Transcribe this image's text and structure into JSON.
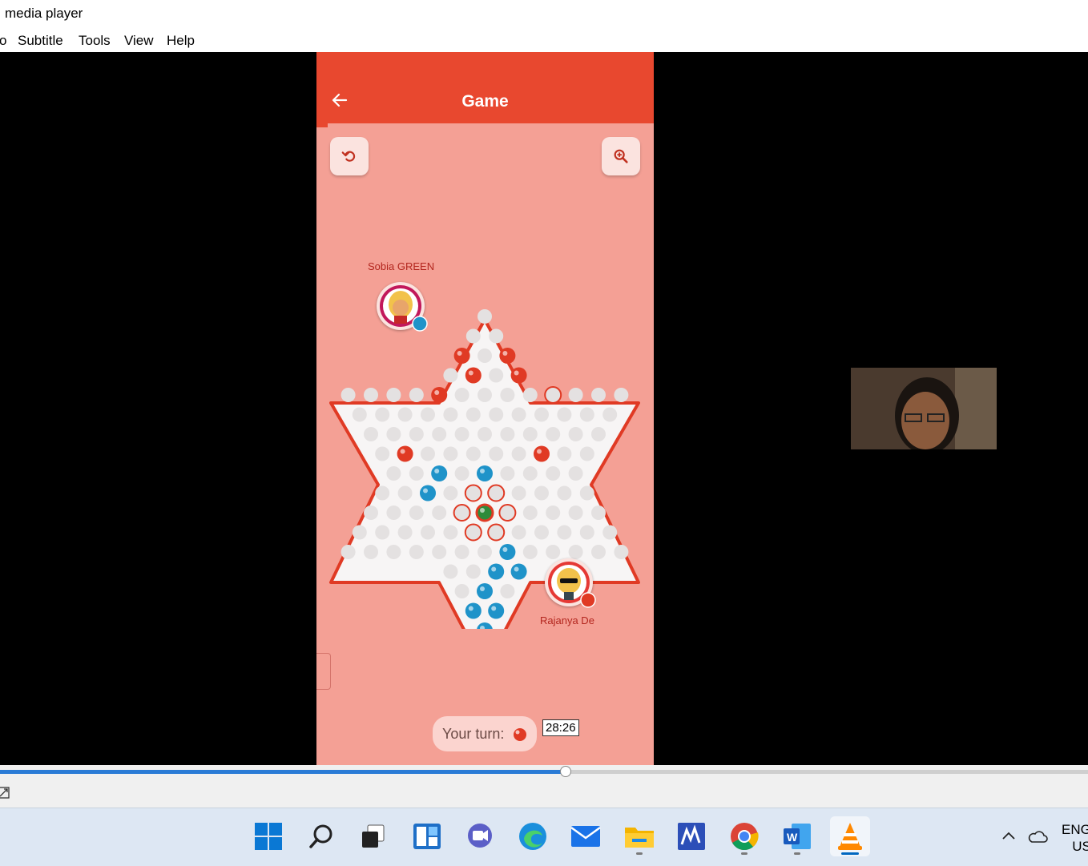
{
  "window": {
    "title": "media player"
  },
  "menu": {
    "items": [
      "o",
      "Subtitle",
      "Tools",
      "View",
      "Help"
    ]
  },
  "game": {
    "title": "Game",
    "player_top": "Sobia GREEN",
    "player_bottom": "Rajanya De",
    "turn_label": "Your turn:",
    "colors": {
      "appbar": "#e8482f",
      "background": "#f4a095",
      "red_marble": "#e03a24",
      "blue_marble": "#1f93c9",
      "green_marble": "#2e8b3a"
    }
  },
  "seek": {
    "tooltip_time": "28:26",
    "progress": 0.52
  },
  "taskbar": {
    "icons": [
      "windows-start-icon",
      "search-icon",
      "task-view-icon",
      "widgets-icon",
      "teams-chat-icon",
      "edge-icon",
      "mail-icon",
      "file-explorer-icon",
      "mathcad-icon",
      "chrome-icon",
      "word-icon",
      "vlc-icon"
    ],
    "lang_line1": "ENG",
    "lang_line2": "US"
  }
}
